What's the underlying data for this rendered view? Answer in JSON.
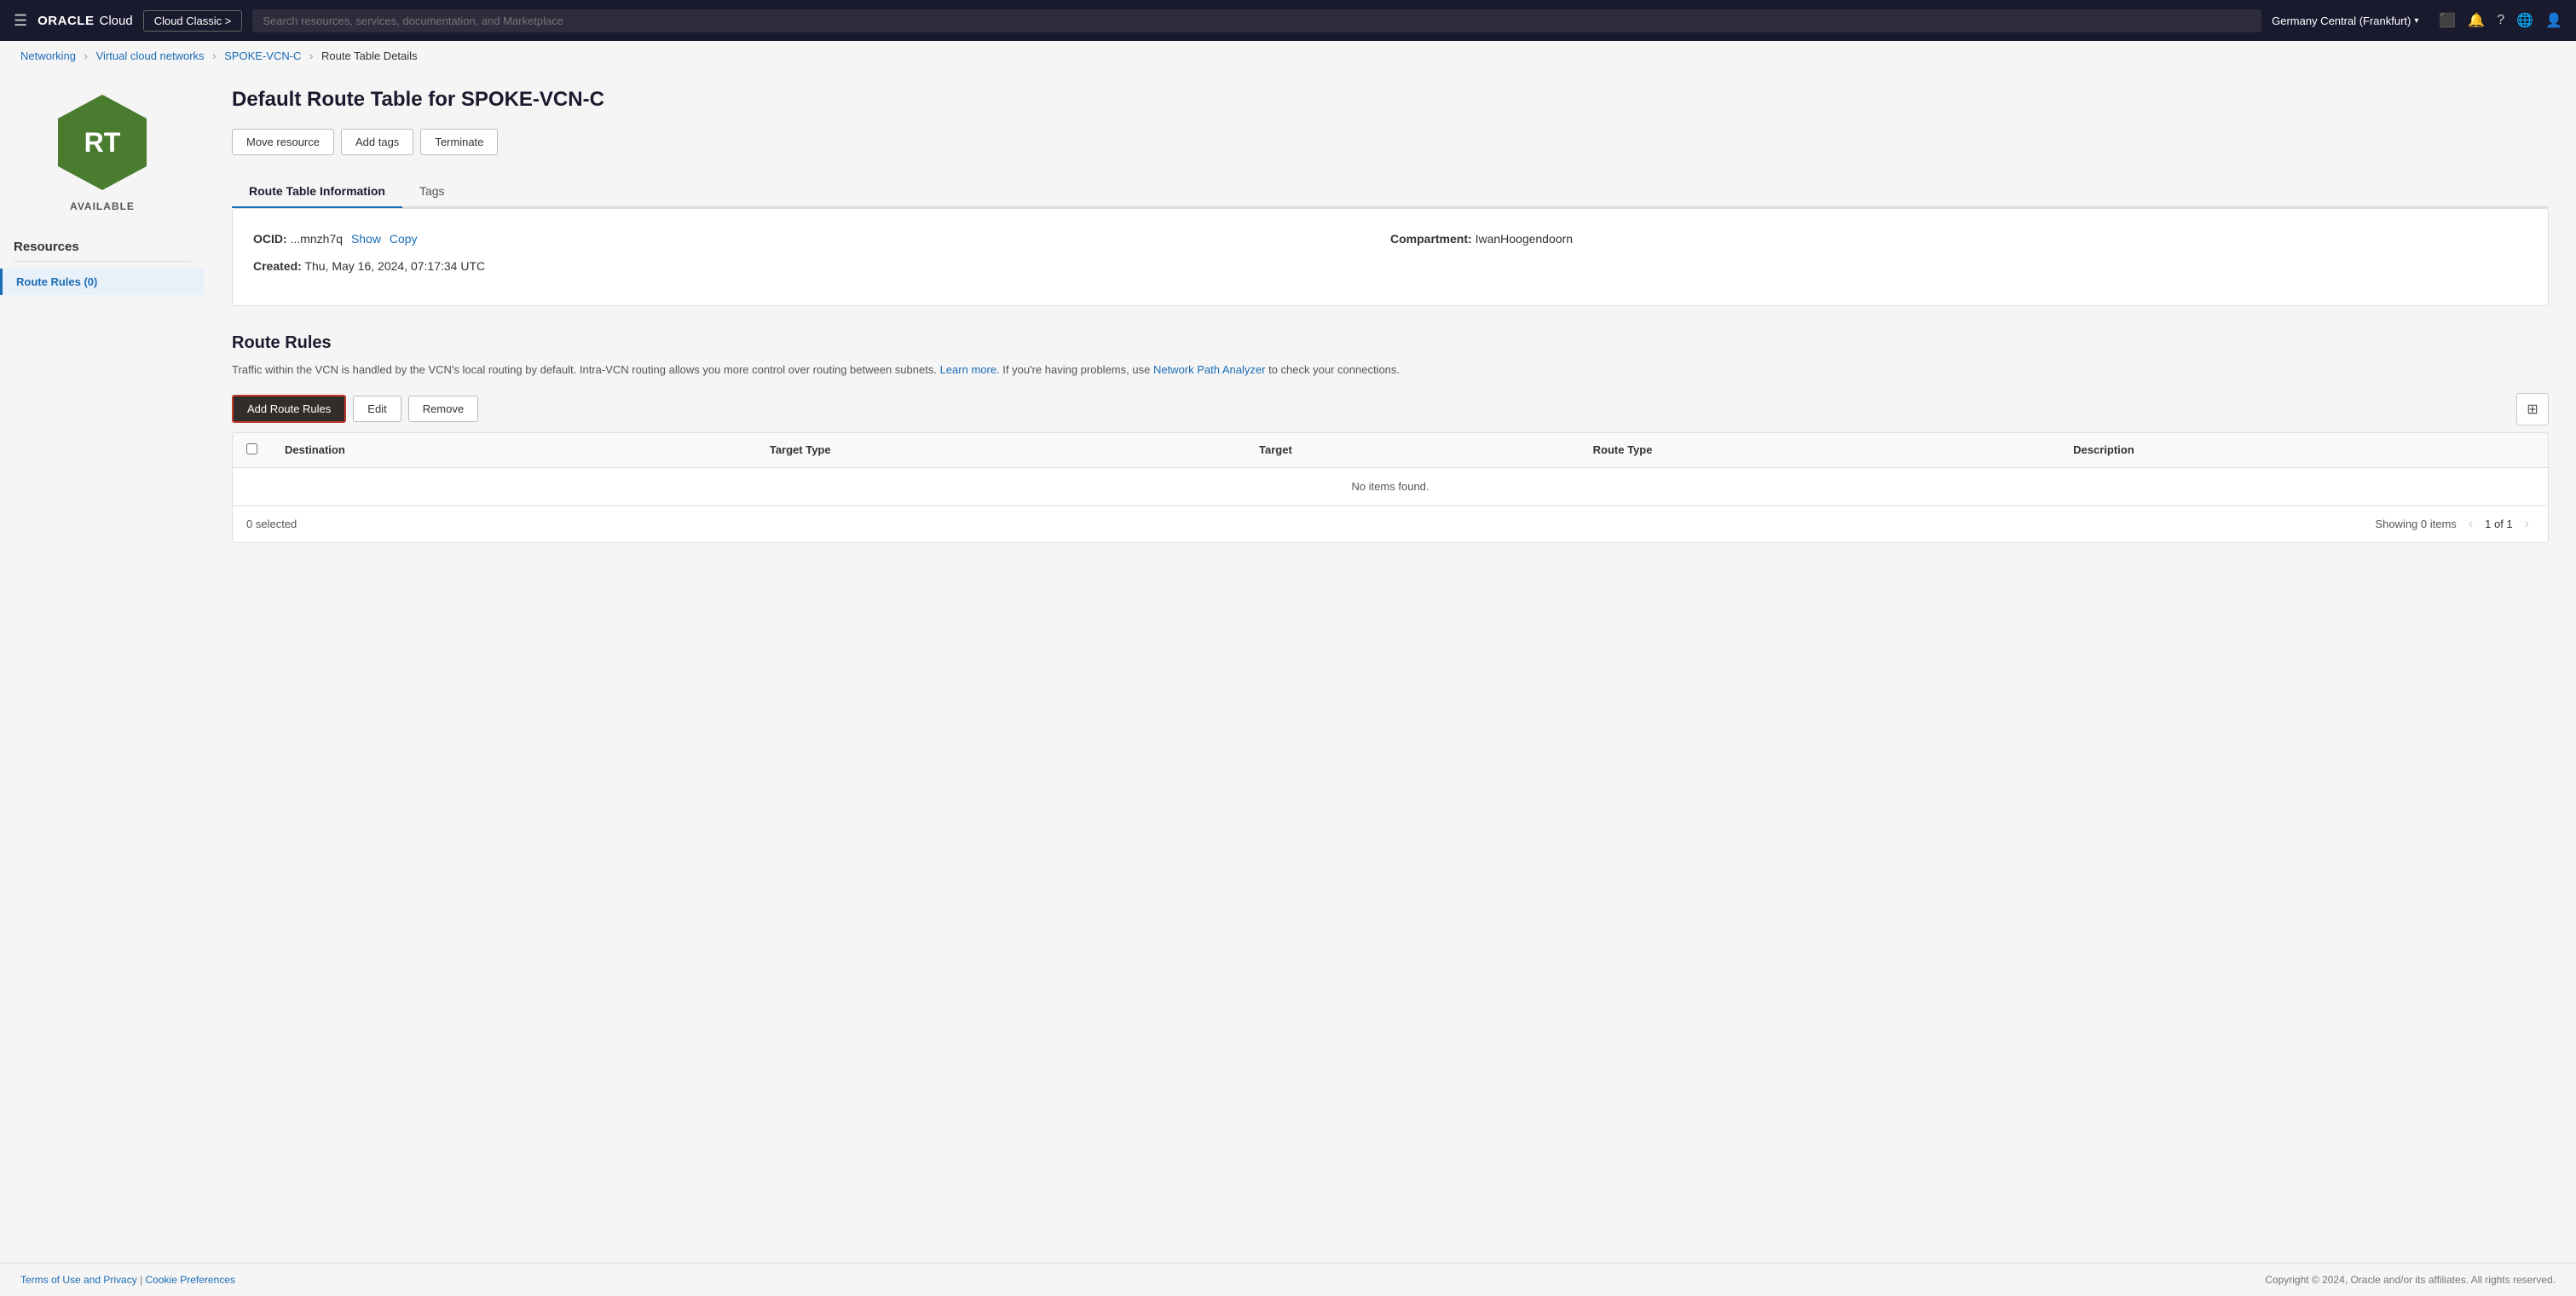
{
  "topnav": {
    "logo_oracle": "ORACLE",
    "logo_cloud": "Cloud",
    "classic_btn": "Cloud Classic >",
    "search_placeholder": "Search resources, services, documentation, and Marketplace",
    "region": "Germany Central (Frankfurt)",
    "region_chevron": "▾"
  },
  "breadcrumb": {
    "networking": "Networking",
    "vcn": "Virtual cloud networks",
    "vcn_name": "SPOKE-VCN-C",
    "current": "Route Table Details"
  },
  "sidebar": {
    "status": "AVAILABLE",
    "rt_letters": "RT",
    "resources_title": "Resources",
    "items": [
      {
        "label": "Route Rules (0)",
        "active": true
      }
    ]
  },
  "header": {
    "title": "Default Route Table for SPOKE-VCN-C"
  },
  "action_buttons": [
    {
      "label": "Move resource"
    },
    {
      "label": "Add tags"
    },
    {
      "label": "Terminate"
    }
  ],
  "tabs": [
    {
      "label": "Route Table Information",
      "active": true
    },
    {
      "label": "Tags",
      "active": false
    }
  ],
  "info": {
    "ocid_label": "OCID:",
    "ocid_value": "...mnzh7q",
    "ocid_show": "Show",
    "ocid_copy": "Copy",
    "created_label": "Created:",
    "created_value": "Thu, May 16, 2024, 07:17:34 UTC",
    "compartment_label": "Compartment:",
    "compartment_value": "IwanHoogendoorn"
  },
  "route_rules": {
    "title": "Route Rules",
    "description_part1": "Traffic within the VCN is handled by the VCN's local routing by default. Intra-VCN routing allows you more control over routing between subnets.",
    "learn_more": "Learn more.",
    "description_part2": "If you're having problems, use",
    "network_path_analyzer": "Network Path Analyzer",
    "description_part3": "to check your connections.",
    "add_btn": "Add Route Rules",
    "edit_btn": "Edit",
    "remove_btn": "Remove",
    "table": {
      "columns": [
        "Destination",
        "Target Type",
        "Target",
        "Route Type",
        "Description"
      ],
      "no_items": "No items found.",
      "selected_count": "0 selected",
      "showing": "Showing 0 items",
      "page_info": "1 of 1"
    }
  },
  "footer": {
    "terms": "Terms of Use and Privacy",
    "cookies": "Cookie Preferences",
    "copyright": "Copyright © 2024, Oracle and/or its affiliates. All rights reserved."
  }
}
